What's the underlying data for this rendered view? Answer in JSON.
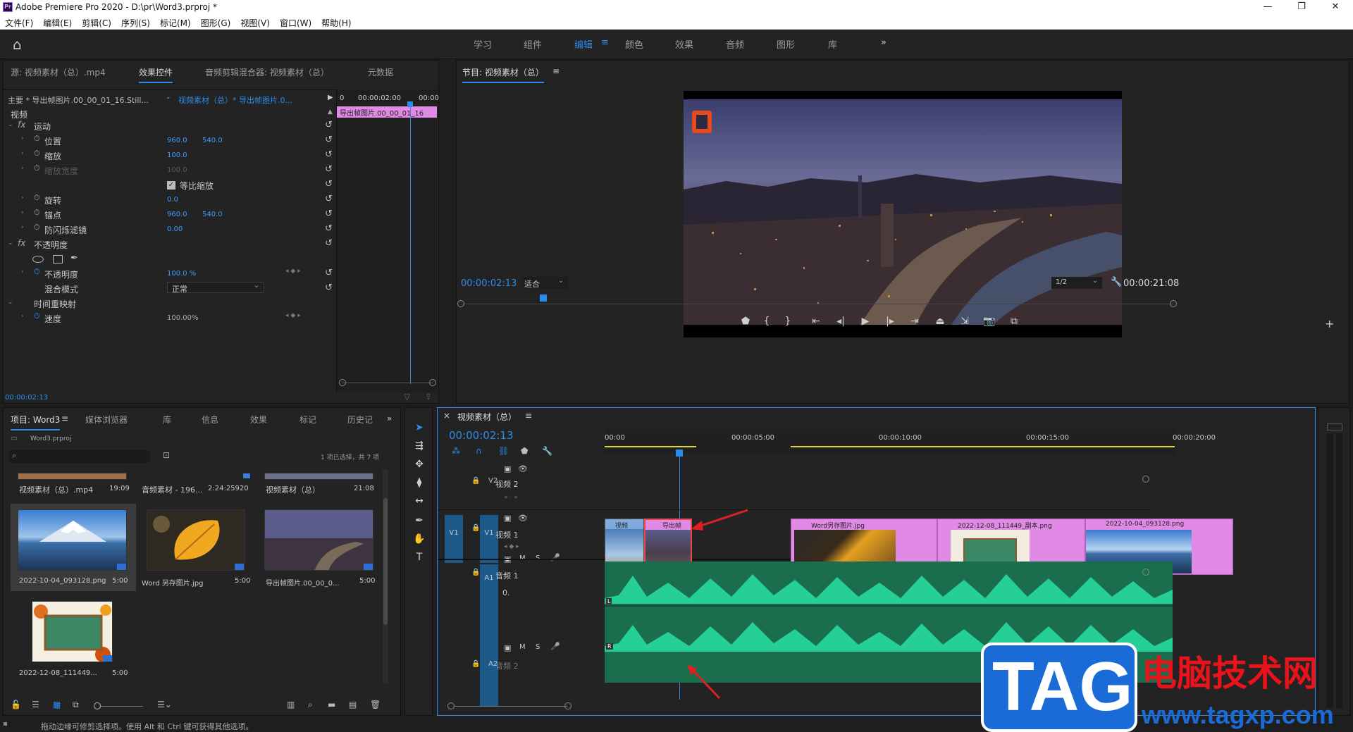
{
  "window": {
    "title": "Adobe Premiere Pro 2020 - D:\\pr\\Word3.prproj *",
    "icon": "Pr",
    "min": "—",
    "max": "❐",
    "close": "✕"
  },
  "menu": [
    "文件(F)",
    "编辑(E)",
    "剪辑(C)",
    "序列(S)",
    "标记(M)",
    "图形(G)",
    "视图(V)",
    "窗口(W)",
    "帮助(H)"
  ],
  "workspaces": {
    "items": [
      "学习",
      "组件",
      "编辑",
      "颜色",
      "效果",
      "音频",
      "图形",
      "库"
    ],
    "active": "编辑",
    "menu_icon": "≡",
    "more": "»"
  },
  "source_panel": {
    "tabs": [
      "源: 视频素材（总）.mp4",
      "效果控件",
      "音频剪辑混合器: 视频素材（总）",
      "元数据"
    ],
    "active_tab": "效果控件",
    "header_left": "主要 * 导出帧图片.00_00_01_16.Still...",
    "header_right": "视频素材（总）* 导出帧图片.0...",
    "mini_times": [
      "0",
      "00:00:02:00",
      "00:00"
    ],
    "mini_clip": "导出帧图片.00_00_01_16",
    "section_video": "视频",
    "motion": "运动",
    "rows": [
      {
        "label": "位置",
        "v1": "960.0",
        "v2": "540.0"
      },
      {
        "label": "缩放",
        "v1": "100.0",
        "v2": ""
      },
      {
        "label": "缩放宽度",
        "v1": "100.0",
        "v2": "",
        "disabled": true
      },
      {
        "label": "等比缩放",
        "v1": "",
        "v2": ""
      },
      {
        "label": "旋转",
        "v1": "0.0",
        "v2": ""
      },
      {
        "label": "锚点",
        "v1": "960.0",
        "v2": "540.0"
      },
      {
        "label": "防闪烁滤镜",
        "v1": "0.00",
        "v2": ""
      }
    ],
    "opacity": "不透明度",
    "opacity_value": "100.0 %",
    "blend_label": "混合模式",
    "blend_value": "正常",
    "time_remap": "时间重映射",
    "speed_label": "速度",
    "speed_value": "100.00%",
    "timecode": "00:00:02:13"
  },
  "program_monitor": {
    "title": "节目: 视频素材（总）",
    "timecode": "00:00:02:13",
    "fit": "适合",
    "resolution": "1/2",
    "duration": "00:00:21:08"
  },
  "project_panel": {
    "tabs": [
      "项目: Word3",
      "媒体浏览器",
      "库",
      "信息",
      "效果",
      "标记",
      "历史记"
    ],
    "active_tab": "项目: Word3",
    "file": "Word3.prproj",
    "selection": "1 项已选择，共 7 项",
    "items": [
      {
        "name": "视频素材（总）.mp4",
        "dur": "19:09"
      },
      {
        "name": "音频素材 - 196...",
        "dur": "2:24:25920"
      },
      {
        "name": "视频素材（总）",
        "dur": "21:08"
      },
      {
        "name": "2022-10-04_093128.png",
        "dur": "5:00"
      },
      {
        "name": "Word 另存图片.jpg",
        "dur": "5:00"
      },
      {
        "name": "导出帧图片.00_00_0...",
        "dur": "5:00"
      },
      {
        "name": "2022-12-08_111449...",
        "dur": "5:00"
      }
    ]
  },
  "timeline": {
    "title": "视频素材（总）",
    "timecode": "00:00:02:13",
    "ruler": [
      "00:00",
      "00:00:05:00",
      "00:00:10:00",
      "00:00:15:00",
      "00:00:20:00"
    ],
    "tracks": {
      "v2": "V2",
      "v2_name": "视频 2",
      "v1": "V1",
      "v1_name": "视频 1",
      "a1": "A1",
      "a1_name": "音频 1",
      "a2": "A2",
      "a2_name": "音频 2",
      "src_v1": "V1"
    },
    "clips": [
      "视频",
      "导出帧",
      "Word另存图片.jpg",
      "2022-12-08_111449_副本.png",
      "2022-10-04_093128.png"
    ],
    "audio_letters": [
      "L",
      "R"
    ],
    "mute": "M",
    "solo": "S",
    "vol_knob": "0."
  },
  "status_bar": "拖动边缘可修剪选择项。使用 Alt 和 Ctrl 键可获得其他选项。",
  "watermark": {
    "tag": "TAG",
    "cn": "电脑技术网",
    "url": "www.tagxp.com"
  },
  "colors": {
    "accent": "#2d8ceb",
    "panel": "#232323",
    "clip_pink": "#e08ae6",
    "audio_green": "#25c994"
  }
}
